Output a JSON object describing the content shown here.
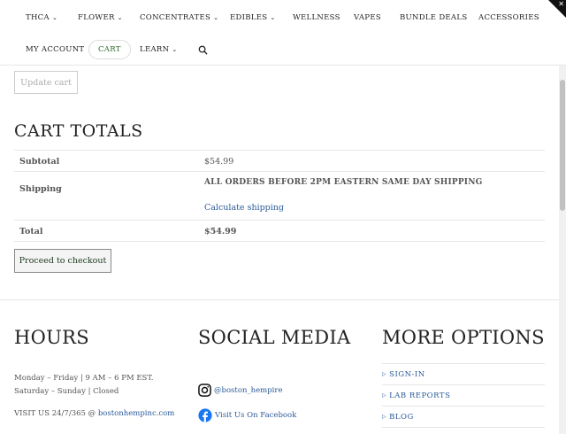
{
  "nav": {
    "row1": [
      {
        "label": "THCA",
        "chevron": true
      },
      {
        "label": "FLOWER",
        "chevron": true
      },
      {
        "label": "CONCENTRATES",
        "chevron": true
      },
      {
        "label": "EDIBLES",
        "chevron": true
      },
      {
        "label": "WELLNESS",
        "chevron": false
      },
      {
        "label": "VAPES",
        "chevron": false
      },
      {
        "label": "BUNDLE DEALS",
        "chevron": false
      },
      {
        "label": "ACCESSORIES",
        "chevron": false
      }
    ],
    "row2": [
      {
        "label": "MY ACCOUNT",
        "chevron": false
      },
      {
        "label": "CART",
        "chevron": false,
        "active": true
      },
      {
        "label": "LEARN",
        "chevron": true
      }
    ],
    "chevron_glyph": "❯",
    "icons": [
      "search-icon"
    ]
  },
  "cart": {
    "update_cart_label": "Update cart",
    "totals_title": "CART TOTALS",
    "subtotal_label": "Subtotal",
    "subtotal_value": "$54.99",
    "shipping_label": "Shipping",
    "shipping_note": "ALL ORDERS BEFORE 2PM EASTERN SAME DAY SHIPPING",
    "calculate_shipping": "Calculate shipping",
    "total_label": "Total",
    "total_value": "$54.99",
    "checkout_label": "Proceed to checkout"
  },
  "footer": {
    "hours": {
      "title": "HOURS",
      "weekday": "Monday – Friday | 9 AM – 6 PM EST.",
      "weekend": "Saturday – Sunday | Closed",
      "visit_prefix": "VISIT US 24/7/365 @ ",
      "visit_link": "bostonhempinc.com"
    },
    "social": {
      "title": "SOCIAL MEDIA",
      "instagram": "@boston_hempire",
      "facebook": "Visit Us On Facebook"
    },
    "more": {
      "title": "MORE OPTIONS",
      "items": [
        "SIGN-IN",
        "LAB REPORTS",
        "BLOG"
      ]
    }
  },
  "colors": {
    "link": "#2a5a9a",
    "cart_active": "#2e6b2e",
    "text": "#555555"
  }
}
